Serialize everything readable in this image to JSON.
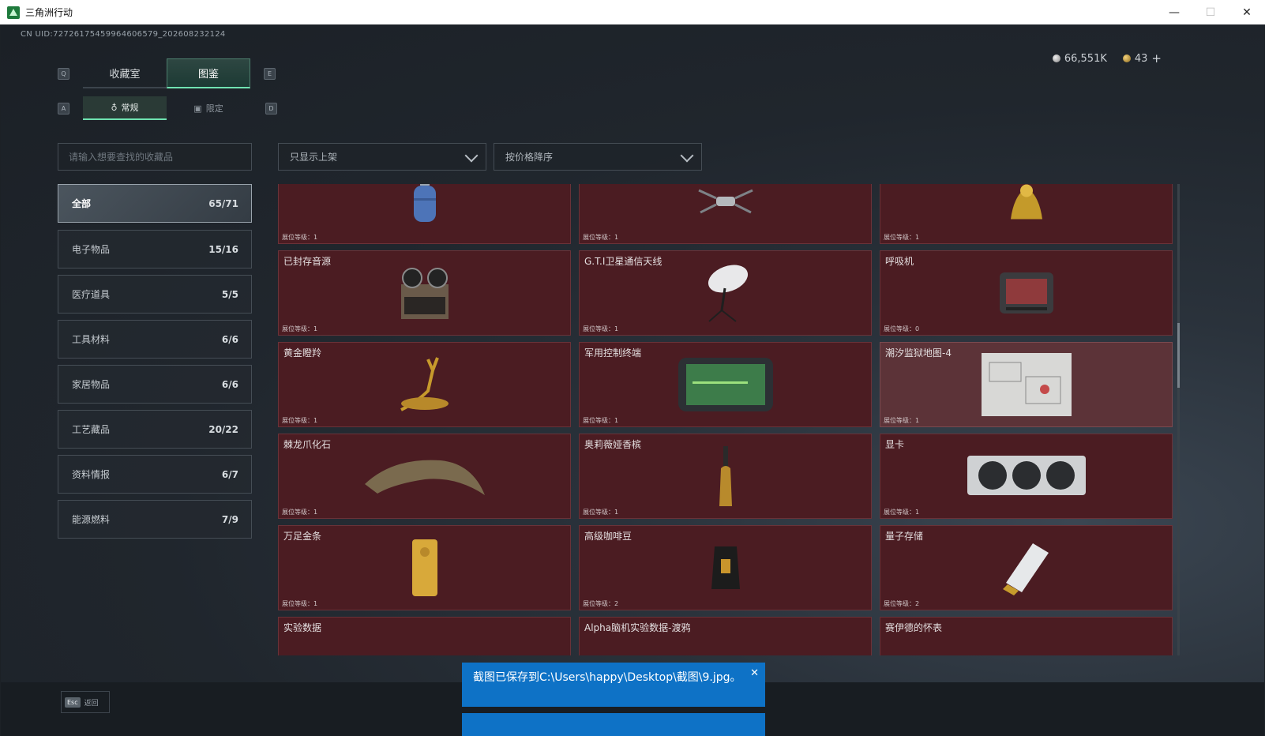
{
  "window": {
    "title": "三角洲行动",
    "minimize": "—",
    "maximize": "☐",
    "close": "✕"
  },
  "uid": "CN UID:72726175459964606579_202608232124",
  "currency": {
    "silver": "66,551K",
    "gold": "43",
    "plus": "+"
  },
  "tabs": {
    "key_left": "Q",
    "key_right": "E",
    "main": [
      {
        "label": "收藏室",
        "active": false
      },
      {
        "label": "图鉴",
        "active": true
      }
    ],
    "sub_key_left": "A",
    "sub_key_right": "D",
    "sub": [
      {
        "label": "常规",
        "active": true
      },
      {
        "label": "限定",
        "active": false
      }
    ]
  },
  "search": {
    "placeholder": "请输入想要查找的收藏品"
  },
  "filters": {
    "shelf": "只显示上架",
    "sort": "按价格降序"
  },
  "categories": [
    {
      "label": "全部",
      "count": "65/71",
      "active": true
    },
    {
      "label": "电子物品",
      "count": "15/16"
    },
    {
      "label": "医疗道具",
      "count": "5/5"
    },
    {
      "label": "工具材料",
      "count": "6/6"
    },
    {
      "label": "家居物品",
      "count": "6/6"
    },
    {
      "label": "工艺藏品",
      "count": "20/22"
    },
    {
      "label": "资料情报",
      "count": "6/7"
    },
    {
      "label": "能源燃料",
      "count": "7/9"
    }
  ],
  "level_label": "展位等级：",
  "items": [
    {
      "name": "",
      "level": "1",
      "icon": "gas-tank-icon"
    },
    {
      "name": "",
      "level": "1",
      "icon": "drone-icon"
    },
    {
      "name": "",
      "level": "1",
      "icon": "golden-statue-icon"
    },
    {
      "name": "已封存音源",
      "level": "1",
      "icon": "tape-recorder-icon"
    },
    {
      "name": "G.T.I卫星通信天线",
      "level": "1",
      "icon": "satellite-dish-icon"
    },
    {
      "name": "呼吸机",
      "level": "0",
      "icon": "ventilator-icon"
    },
    {
      "name": "黄金瞪羚",
      "level": "1",
      "icon": "golden-gazelle-icon"
    },
    {
      "name": "军用控制终端",
      "level": "1",
      "icon": "control-terminal-icon"
    },
    {
      "name": "潮汐监狱地图-4",
      "level": "1",
      "icon": "map-icon"
    },
    {
      "name": "棘龙爪化石",
      "level": "1",
      "icon": "claw-fossil-icon"
    },
    {
      "name": "奥莉薇娅香槟",
      "level": "1",
      "icon": "champagne-icon"
    },
    {
      "name": "显卡",
      "level": "1",
      "icon": "graphics-card-icon"
    },
    {
      "name": "万足金条",
      "level": "1",
      "icon": "gold-bar-icon"
    },
    {
      "name": "高级咖啡豆",
      "level": "2",
      "icon": "coffee-bag-icon"
    },
    {
      "name": "量子存储",
      "level": "2",
      "icon": "quantum-storage-icon"
    },
    {
      "name": "实验数据",
      "level": "",
      "icon": "disc-icon"
    },
    {
      "name": "Alpha脑机实验数据-渡鸦",
      "level": "",
      "icon": "canister-icon"
    },
    {
      "name": "赛伊德的怀表",
      "level": "",
      "icon": "pocket-watch-icon"
    }
  ],
  "bottom": {
    "esc": "Esc",
    "back": "返回"
  },
  "toast": {
    "message": "截图已保存到C:\\Users\\happy\\Desktop\\截图\\9.jpg。",
    "close": "✕"
  }
}
